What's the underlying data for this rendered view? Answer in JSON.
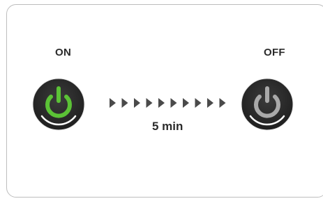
{
  "states": {
    "on": {
      "label": "ON",
      "icon": "power-icon",
      "icon_color": "#5bc236",
      "body_color": "#2e2e2e"
    },
    "off": {
      "label": "OFF",
      "icon": "power-icon",
      "icon_color": "#a9a9a9",
      "body_color": "#2e2e2e"
    }
  },
  "transition": {
    "duration_label": "5 min",
    "arrow_count": 10,
    "arrow_color": "#4a4a4a"
  },
  "colors": {
    "border": "#bdbdbd",
    "text": "#2b2b2b"
  }
}
